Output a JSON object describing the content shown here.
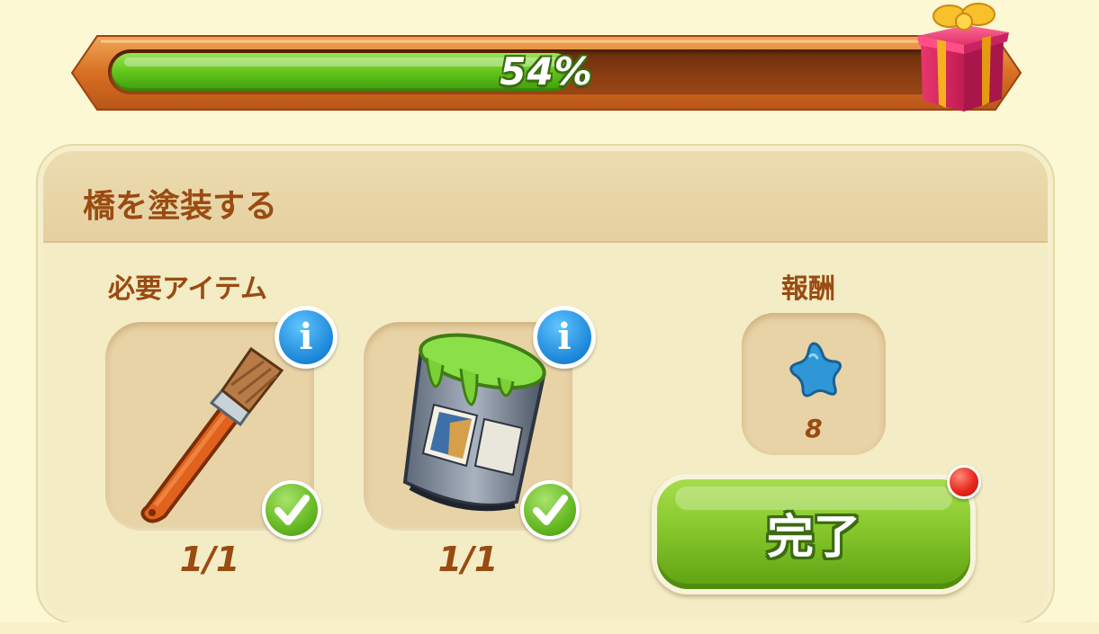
{
  "progress": {
    "percent": 54,
    "label": "54%"
  },
  "panel": {
    "title": "橋を塗装する",
    "required_label": "必要アイテム",
    "reward_label": "報酬"
  },
  "items": [
    {
      "name": "paintbrush",
      "count": "1/1",
      "info_glyph": "i",
      "completed": true
    },
    {
      "name": "green-paint-bucket",
      "count": "1/1",
      "info_glyph": "i",
      "completed": true
    }
  ],
  "reward": {
    "icon": "blue-star-icon",
    "value": "8"
  },
  "complete_button": {
    "label": "完了",
    "has_notification": true
  },
  "colors": {
    "background": "#fdf8d4",
    "text_brown": "#9a4b12",
    "progress_green": "#67c91d",
    "button_green": "#86c82c",
    "info_blue": "#1c86d8",
    "notify_red": "#e8281b"
  }
}
